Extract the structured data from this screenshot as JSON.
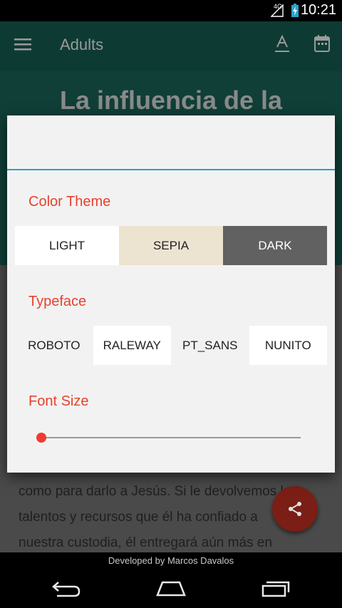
{
  "status_bar": {
    "network": "4G",
    "time": "10:21"
  },
  "app_bar": {
    "title": "Adults",
    "icons": [
      "menu-icon",
      "font-size-icon",
      "calendar-icon"
    ]
  },
  "article": {
    "title": "La influencia de la",
    "body_lines": [
      "como para darlo a Jesús. Si le devolvemos los",
      "talentos y recursos que él ha confiado a",
      "nuestra custodia, él entregará aún más en"
    ]
  },
  "dialog": {
    "color_theme": {
      "label": "Color Theme",
      "options": [
        {
          "label": "LIGHT",
          "background": "#ffffff",
          "color": "#222222"
        },
        {
          "label": "SEPIA",
          "background": "#ede3d1",
          "color": "#222222"
        },
        {
          "label": "DARK",
          "background": "#616161",
          "color": "#ffffff"
        }
      ]
    },
    "typeface": {
      "label": "Typeface",
      "options": [
        "ROBOTO",
        "RALEWAY",
        "PT_SANS",
        "NUNITO"
      ]
    },
    "font_size": {
      "label": "Font Size",
      "value_fraction": 0.0
    }
  },
  "footer": {
    "text": "Developed by Marcos Davalos"
  },
  "colors": {
    "accent": "#e8412c",
    "fab": "#7a1e16",
    "input_line": "#29a3cc"
  }
}
